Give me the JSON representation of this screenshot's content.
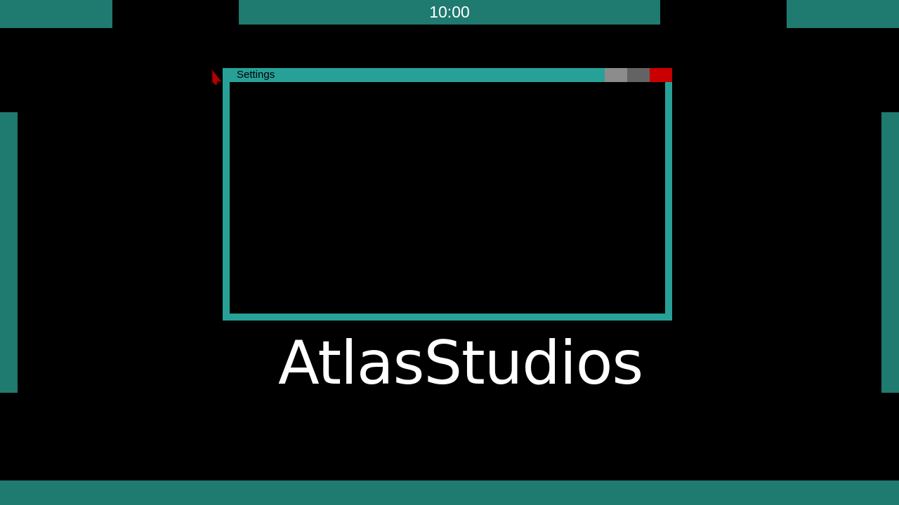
{
  "taskbar": {
    "clock": "10:00"
  },
  "window": {
    "title": "Settings",
    "controls": [
      {
        "name": "minimize",
        "color": "#8c8c8c"
      },
      {
        "name": "maximize",
        "color": "#636363"
      },
      {
        "name": "close",
        "color": "#c80000"
      }
    ]
  },
  "branding": {
    "logo_text": "AtlasStudios"
  },
  "cursor": {
    "icon": "mouse-pointer-icon",
    "color": "#b00000"
  },
  "colors": {
    "panel": "#1f7a70",
    "window_frame": "#27a197",
    "background": "#000000",
    "text_light": "#ffffff"
  }
}
